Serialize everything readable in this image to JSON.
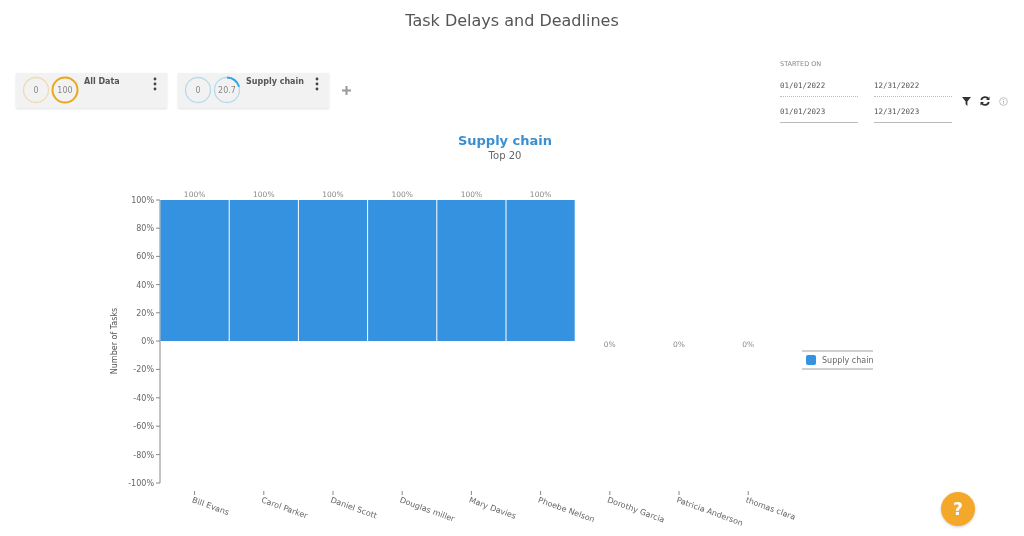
{
  "page": {
    "title": "Task Delays and Deadlines"
  },
  "cards": [
    {
      "title": "All Data",
      "color": "#e8a820",
      "rings": [
        {
          "value": "0"
        },
        {
          "value": "100"
        }
      ]
    },
    {
      "title": "Supply chain",
      "color": "#2ea7e0",
      "rings": [
        {
          "value": "0"
        },
        {
          "value": "20.7"
        }
      ]
    }
  ],
  "date_filter": {
    "label": "STARTED ON",
    "ranges": [
      {
        "from": "01/01/2022",
        "to": "12/31/2022"
      },
      {
        "from": "01/01/2023",
        "to": "12/31/2023"
      }
    ]
  },
  "chart": {
    "chart_data": {
      "type": "bar",
      "title": "Supply chain",
      "subtitle": "Top 20",
      "ylabel": "Number of Tasks",
      "categories": [
        "Bill Evans",
        "Carol Parker",
        "Daniel Scott",
        "Douglas miller",
        "Mary Davies",
        "Phoebe Nelson",
        "Dorothy Garcia",
        "Patricia Anderson",
        "thomas clara"
      ],
      "series": [
        {
          "name": "Supply chain",
          "color": "#3592e0",
          "values": [
            100,
            100,
            100,
            100,
            100,
            100,
            0,
            0,
            0
          ]
        }
      ],
      "ylim": [
        -100,
        100
      ],
      "yticks": [
        {
          "value": 100,
          "label": "100%"
        },
        {
          "value": 80,
          "label": "80%"
        },
        {
          "value": 60,
          "label": "60%"
        },
        {
          "value": 40,
          "label": "40%"
        },
        {
          "value": 20,
          "label": "20%"
        },
        {
          "value": 0,
          "label": "0%"
        },
        {
          "value": -20,
          "label": "-20%"
        },
        {
          "value": -40,
          "label": "-40%"
        },
        {
          "value": -60,
          "label": "-60%"
        },
        {
          "value": -80,
          "label": "-80%"
        },
        {
          "value": -100,
          "label": "-100%"
        }
      ],
      "value_labels": [
        "100%",
        "100%",
        "100%",
        "100%",
        "100%",
        "100%",
        "0%",
        "0%",
        "0%"
      ]
    }
  },
  "help_button": {
    "label": "?"
  }
}
